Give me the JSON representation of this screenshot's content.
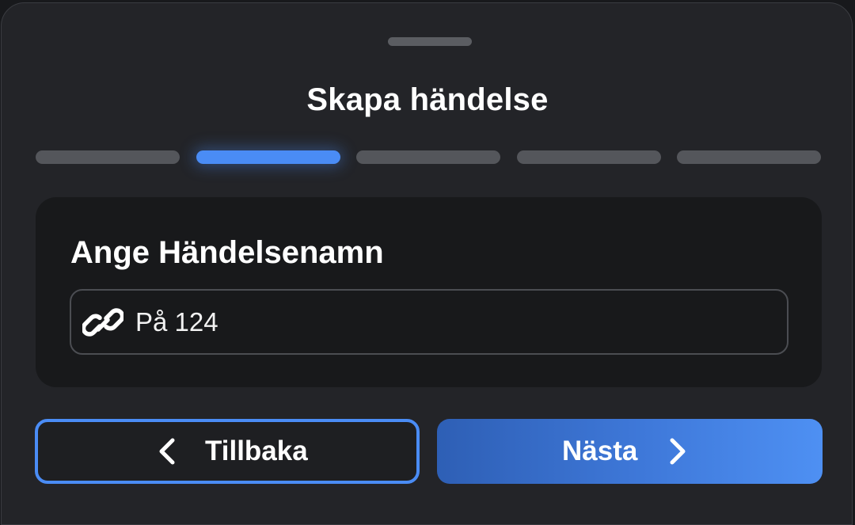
{
  "sheet": {
    "title": "Skapa händelse"
  },
  "progress": {
    "total_steps": 5,
    "current_step": 2
  },
  "card": {
    "heading": "Ange Händelsenamn",
    "input": {
      "value": "På 124",
      "icon": "link-icon"
    }
  },
  "buttons": {
    "back_label": "Tillbaka",
    "back_icon": "chevron-left-icon",
    "next_label": "Nästa",
    "next_icon": "chevron-right-icon"
  },
  "colors": {
    "accent": "#4a8cf5",
    "background": "#232428",
    "card": "#18191b",
    "inactive_step": "#54565b"
  }
}
